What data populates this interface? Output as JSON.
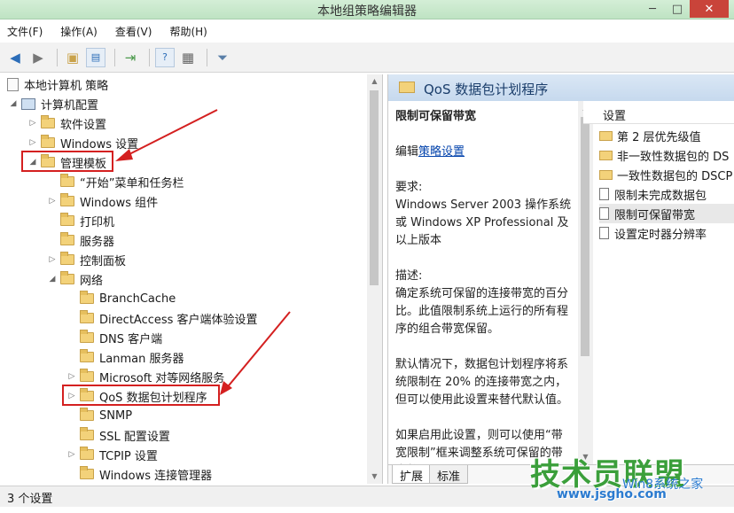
{
  "window": {
    "title": "本地组策略编辑器"
  },
  "menu": [
    "文件(F)",
    "操作(A)",
    "查看(V)",
    "帮助(H)"
  ],
  "tree": {
    "root": "本地计算机 策略",
    "computer_config": "计算机配置",
    "items": [
      "软件设置",
      "Windows 设置",
      "管理模板",
      "“开始”菜单和任务栏",
      "Windows 组件",
      "打印机",
      "服务器",
      "控制面板",
      "网络",
      "BranchCache",
      "DirectAccess 客户端体验设置",
      "DNS 客户端",
      "Lanman 服务器",
      "Microsoft 对等网络服务",
      "QoS 数据包计划程序",
      "SNMP",
      "SSL 配置设置",
      "TCPIP 设置",
      "Windows 连接管理器"
    ]
  },
  "right": {
    "header": "QoS 数据包计划程序",
    "policy_title": "限制可保留带宽",
    "edit_prefix": "编辑",
    "edit_link": "策略设置",
    "req_label": "要求:",
    "req_text": "Windows Server 2003 操作系统或 Windows XP Professional 及以上版本",
    "desc_label": "描述:",
    "desc_text_1": "确定系统可保留的连接带宽的百分比。此值限制系统上运行的所有程序的组合带宽保留。",
    "desc_text_2": "默认情况下，数据包计划程序将系统限制在 20% 的连接带宽之内，但可以使用此设置来替代默认值。",
    "desc_text_3": "如果启用此设置，则可以使用“带宽限制”框来调整系统可保留的带宽数量。",
    "settings_header": "设置",
    "settings": [
      "第 2 层优先级值",
      "非一致性数据包的 DS",
      "一致性数据包的 DSCP",
      "限制未完成数据包",
      "限制可保留带宽",
      "设置定时器分辨率"
    ],
    "tabs": [
      "扩展",
      "标准"
    ]
  },
  "status": "3 个设置",
  "watermark": {
    "big": "技术员联盟",
    "url": "www.jsgho.com",
    "win": "Win8系统之家"
  }
}
